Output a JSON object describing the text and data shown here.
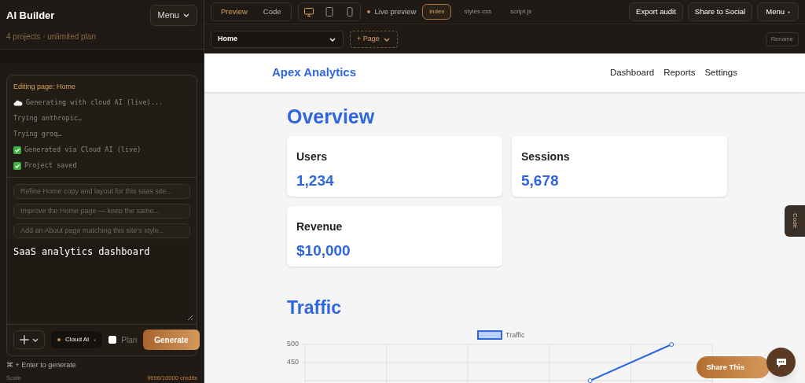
{
  "sidebar": {
    "title": "AI Builder",
    "menu_button": "Menu",
    "subtitle": "4 projects · unlimited plan",
    "log": {
      "heading": "Editing page: Home",
      "lines": [
        {
          "kind": "cloud",
          "text": "Generating with cloud AI (live)..."
        },
        {
          "kind": "plain",
          "text": "Trying anthropic…"
        },
        {
          "kind": "plain",
          "text": "Trying groq…"
        },
        {
          "kind": "done",
          "text": "Generated via Cloud AI (live)"
        },
        {
          "kind": "done",
          "text": "Project saved"
        }
      ]
    },
    "suggestions": [
      "Refine Home copy and layout for this saas site...",
      "Improve the Home page — keep the same...",
      "Add an About page matching this site's style..."
    ],
    "prompt": "SaaS analytics dashboard",
    "model": "Cloud AI",
    "plan": {
      "label": "Plan",
      "checked": false
    },
    "generate": "Generate",
    "hint": "⌘ + Enter to generate",
    "footer_left": "Scale",
    "credits": "9996/10000 credits"
  },
  "toolbar": {
    "view_tabs": [
      {
        "label": "Preview",
        "selected": true
      },
      {
        "label": "Code",
        "selected": false
      }
    ],
    "devices": [
      {
        "kind": "desktop",
        "selected": true
      },
      {
        "kind": "tablet",
        "selected": false
      },
      {
        "kind": "phone",
        "selected": false
      }
    ],
    "live": "Live preview",
    "files": [
      {
        "label": "index",
        "selected": true
      },
      {
        "label": "styles.css",
        "selected": false
      },
      {
        "label": "script.js",
        "selected": false
      }
    ],
    "buttons": [
      "Export audit",
      "Share to Social"
    ],
    "menu": "Menu"
  },
  "page_bar": {
    "page": "Home",
    "add_page": "+ Page",
    "rename": "Rename"
  },
  "preview": {
    "brand": "Apex Analytics",
    "nav": [
      "Dashboard",
      "Reports",
      "Settings"
    ],
    "heading": "Overview",
    "stats": [
      {
        "label": "Users",
        "value": "1,234"
      },
      {
        "label": "Sessions",
        "value": "5,678"
      },
      {
        "label": "Revenue",
        "value": "$10,000"
      }
    ],
    "section": "Traffic",
    "chart_data": {
      "type": "line",
      "series": [
        {
          "name": "Traffic",
          "color": "#2f66e0",
          "marker": "circle",
          "values": [
            null,
            null,
            null,
            400,
            500
          ]
        }
      ],
      "categories": [
        null,
        null,
        null,
        null,
        null
      ],
      "ylim": [
        400,
        500
      ],
      "yticks": [
        450,
        500
      ]
    },
    "share": "Share This",
    "code_tab": "Code"
  }
}
